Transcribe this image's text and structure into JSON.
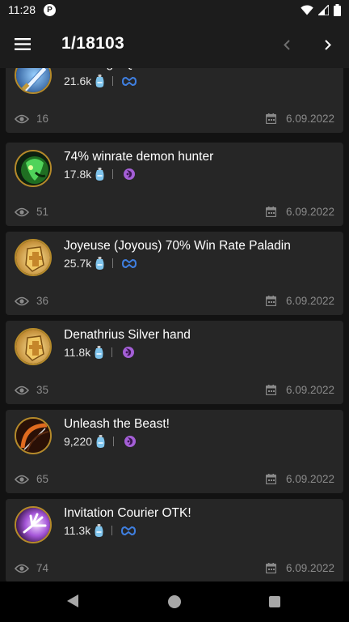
{
  "status": {
    "time": "11:28",
    "app_icon": "P"
  },
  "header": {
    "title": "1/18103",
    "menu_icon": "hamburger-menu-icon",
    "prev_icon": "chevron-left-icon",
    "next_icon": "chevron-right-icon"
  },
  "decks": [
    {
      "title": "Mid-range Quest",
      "dust": "21.6k",
      "mode": "standard",
      "views": "16",
      "date": "6.09.2022",
      "art": "blue-sword"
    },
    {
      "title": "74% winrate demon hunter",
      "dust": "17.8k",
      "mode": "wild",
      "views": "51",
      "date": "6.09.2022",
      "art": "green-demon"
    },
    {
      "title": "Joyeuse (Joyous) 70% Win Rate Paladin",
      "dust": "25.7k",
      "mode": "standard",
      "views": "36",
      "date": "6.09.2022",
      "art": "paladin-shield"
    },
    {
      "title": "Denathrius Silver hand",
      "dust": "11.8k",
      "mode": "wild",
      "views": "35",
      "date": "6.09.2022",
      "art": "paladin-shield"
    },
    {
      "title": "Unleash the Beast!",
      "dust": "9,220",
      "mode": "wild",
      "views": "65",
      "date": "6.09.2022",
      "art": "hunter-bow"
    },
    {
      "title": "Invitation Courier OTK!",
      "dust": "11.3k",
      "mode": "standard",
      "views": "74",
      "date": "6.09.2022",
      "art": "priest-hand"
    }
  ],
  "colors": {
    "standard": "#3f7fe0",
    "wild": "#a45fd6",
    "dust": "#7fc4ec",
    "card_bg": "#262626",
    "frame": "#b58a2a"
  }
}
